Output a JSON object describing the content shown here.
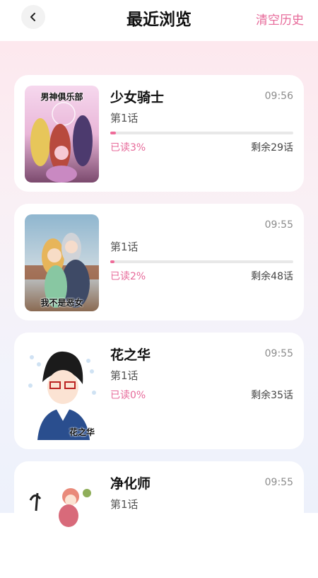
{
  "header": {
    "title": "最近浏览",
    "clear_label": "清空历史"
  },
  "items": [
    {
      "title": "少女骑士",
      "time": "09:56",
      "chapter": "第1话",
      "read": "已读3%",
      "read_fraction": 0.03,
      "remaining": "剩余29话",
      "cover_text": "男神俱乐部"
    },
    {
      "title": "",
      "time": "09:55",
      "chapter": "第1话",
      "read": "已读2%",
      "read_fraction": 0.02,
      "remaining": "剩余48话",
      "cover_text": "我不是恶女"
    },
    {
      "title": "花之华",
      "time": "09:55",
      "chapter": "第1话",
      "read": "已读0%",
      "read_fraction": 0.0,
      "remaining": "剩余35话",
      "cover_text": "花之华"
    },
    {
      "title": "净化师",
      "time": "09:55",
      "chapter": "第1话"
    }
  ],
  "colors": {
    "accent": "#e76a9a",
    "progress": "#ee6c99"
  },
  "icons": {
    "back": "chevron-left-icon"
  }
}
